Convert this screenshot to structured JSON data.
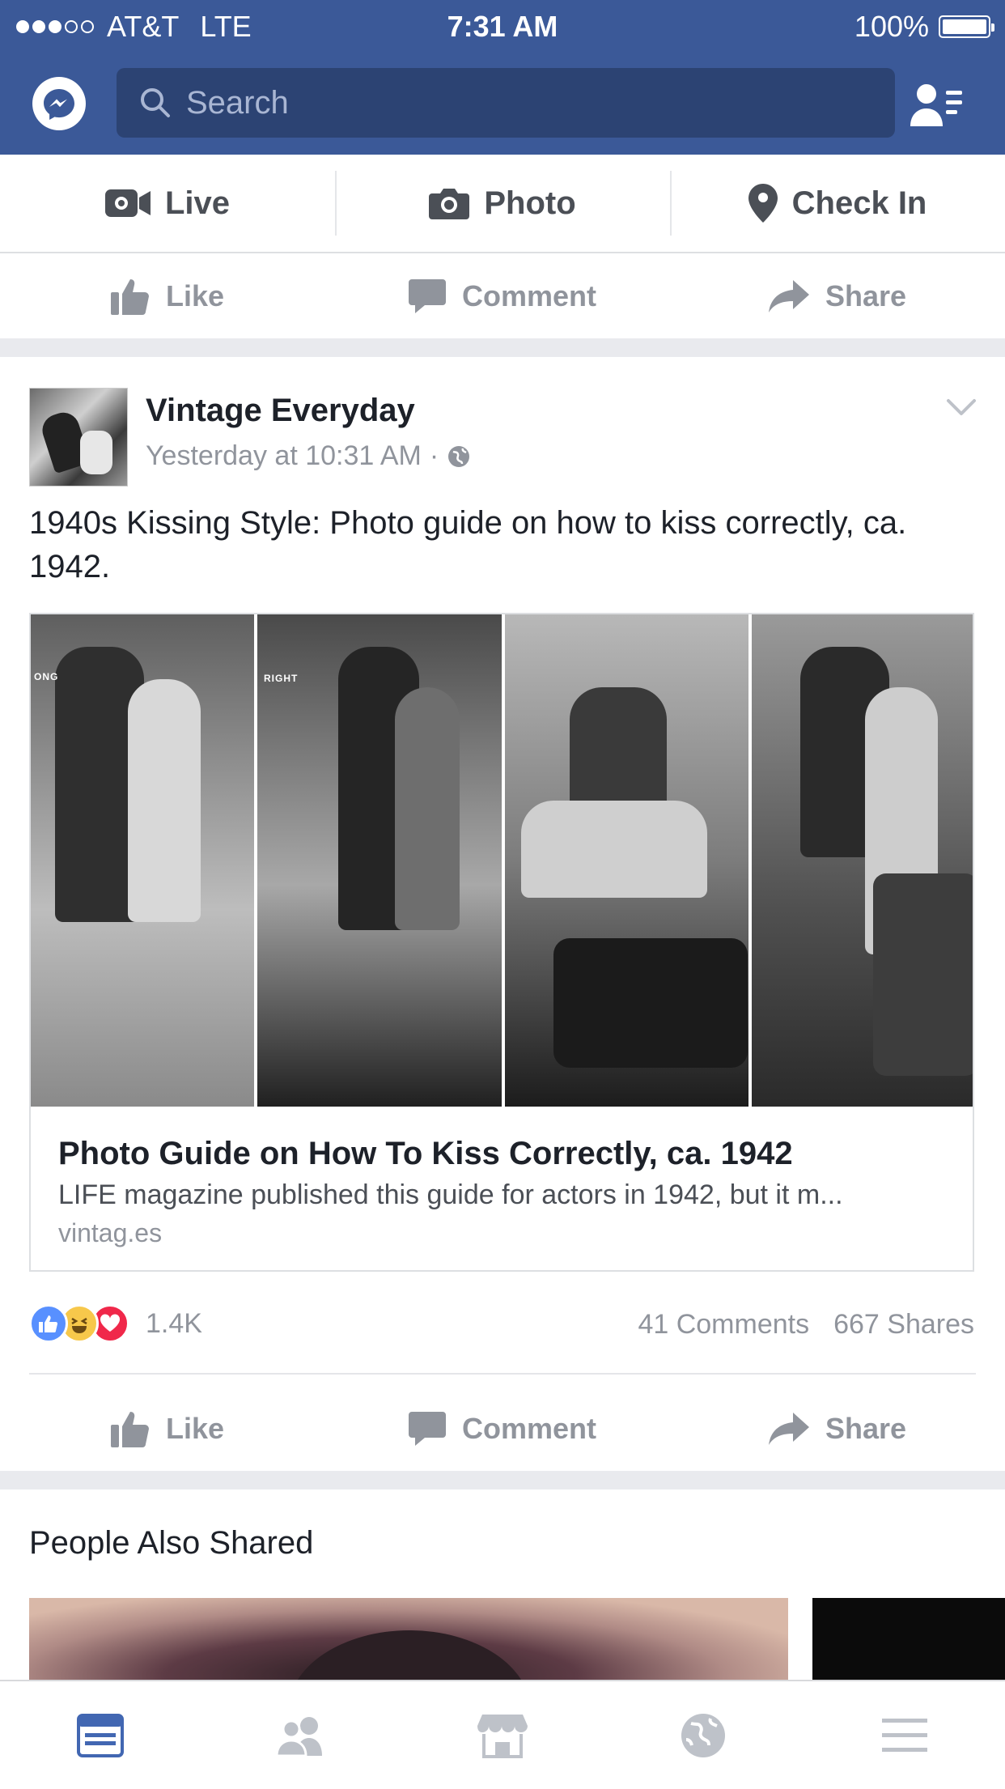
{
  "status_bar": {
    "carrier": "AT&T",
    "network": "LTE",
    "time": "7:31 AM",
    "battery": "100%",
    "signal_bars": 3,
    "signal_total": 5
  },
  "header": {
    "search_placeholder": "Search",
    "icons": {
      "messenger": "messenger-icon",
      "friends": "friend-requests-icon"
    },
    "color": "#3b5998"
  },
  "composer": {
    "live": "Live",
    "photo": "Photo",
    "checkin": "Check In"
  },
  "actions": {
    "like": "Like",
    "comment": "Comment",
    "share": "Share"
  },
  "post": {
    "page_name": "Vintage Everyday",
    "timestamp": "Yesterday at 10:31 AM",
    "separator": "·",
    "text": "1940s Kissing Style: Photo guide on how to kiss correctly, ca. 1942.",
    "link": {
      "title": "Photo Guide on How To Kiss Correctly, ca. 1942",
      "description": "LIFE magazine published this guide for actors in 1942, but it m...",
      "domain": "vintag.es",
      "image_captions": {
        "panel1": "ONG",
        "panel2": "RIGHT"
      }
    },
    "reactions_count": "1.4K",
    "comments": "41 Comments",
    "shares": "667 Shares"
  },
  "people_also_shared": {
    "title": "People Also Shared"
  },
  "tabbar": {
    "items": [
      "news-feed-icon",
      "friends-icon",
      "marketplace-icon",
      "notifications-globe-icon",
      "menu-icon"
    ],
    "active_color": "#4267b2",
    "inactive_color": "#bec2c9"
  }
}
